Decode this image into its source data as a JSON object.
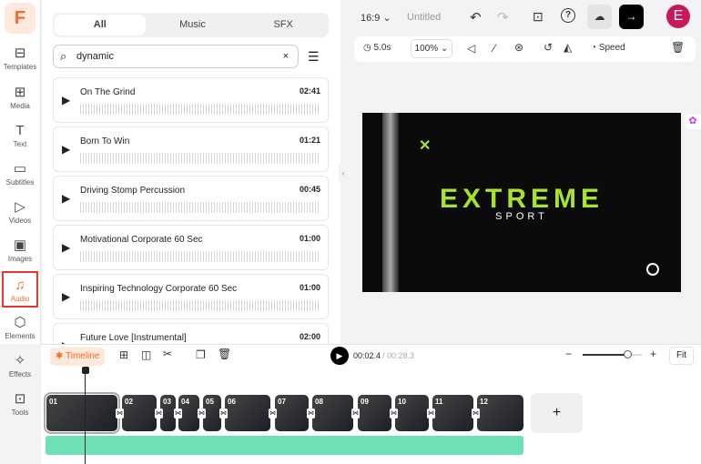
{
  "sidebar": {
    "logo": "F",
    "items": [
      {
        "label": "Templates",
        "icon": "templates-icon",
        "glyph": "⊟"
      },
      {
        "label": "Media",
        "icon": "media-icon",
        "glyph": "⊞"
      },
      {
        "label": "Text",
        "icon": "text-icon",
        "glyph": "T"
      },
      {
        "label": "Subtitles",
        "icon": "subtitles-icon",
        "glyph": "▭"
      },
      {
        "label": "Videos",
        "icon": "videos-icon",
        "glyph": "▷"
      },
      {
        "label": "Images",
        "icon": "images-icon",
        "glyph": "▣"
      },
      {
        "label": "Audio",
        "icon": "audio-icon",
        "glyph": "♫"
      },
      {
        "label": "Elements",
        "icon": "elements-icon",
        "glyph": "⬡"
      },
      {
        "label": "Effects",
        "icon": "effects-icon",
        "glyph": "✧"
      },
      {
        "label": "Tools",
        "icon": "tools-icon",
        "glyph": "⊡"
      }
    ],
    "active": "Audio",
    "accent": "#f26b2a"
  },
  "panel": {
    "tabs": [
      "All",
      "Music",
      "SFX"
    ],
    "active_tab": "All",
    "search": {
      "value": "dynamic",
      "clear": "×"
    },
    "tracks": [
      {
        "name": "On The Grind",
        "duration": "02:41"
      },
      {
        "name": "Born To Win",
        "duration": "01:21"
      },
      {
        "name": "Driving Stomp Percussion",
        "duration": "00:45"
      },
      {
        "name": "Motivational Corporate 60 Sec",
        "duration": "01:00"
      },
      {
        "name": "Inspiring Technology Corporate 60 Sec",
        "duration": "01:00"
      },
      {
        "name": "Future Love [Instrumental]",
        "duration": "02:00"
      }
    ]
  },
  "topbar": {
    "aspect": "16:9",
    "title": "Untitled",
    "avatar": "E"
  },
  "toolbar": {
    "duration": "5.0s",
    "zoom": "100%",
    "speed": "Speed"
  },
  "preview": {
    "title": "EXTREME",
    "subtitle": "SPORT",
    "accent": "#a6e22e"
  },
  "timeline": {
    "label": "Timeline",
    "current": "00:02.4",
    "total": "/ 00:28.3",
    "fit": "Fit",
    "zoom_level": 0.75,
    "clips": [
      "01",
      "02",
      "03",
      "04",
      "05",
      "06",
      "07",
      "08",
      "09",
      "10",
      "11",
      "12"
    ],
    "add": "+"
  }
}
